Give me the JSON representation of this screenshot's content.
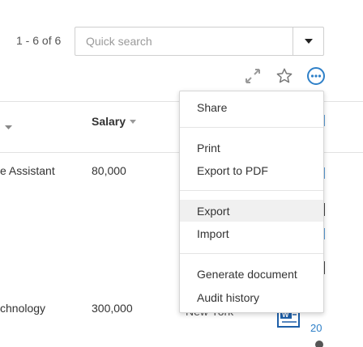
{
  "pager": {
    "range_label": "1 - 6 of 6"
  },
  "search": {
    "placeholder": "Quick search",
    "value": ""
  },
  "toolbar": {
    "icons": [
      "expand-icon",
      "star-icon",
      "more-options-icon"
    ]
  },
  "table": {
    "columns": [
      {
        "label": ""
      },
      {
        "label": "Salary"
      }
    ],
    "rows": [
      {
        "title": "e Assistant",
        "salary": "80,000"
      },
      {
        "title": "chnology",
        "salary": "300,000",
        "location_partial": "New York"
      }
    ],
    "partial_right_text": [
      "Gr",
      "20"
    ]
  },
  "menu": {
    "sections": [
      [
        {
          "label": "Share"
        }
      ],
      [
        {
          "label": "Print"
        },
        {
          "label": "Export to PDF"
        }
      ],
      [
        {
          "label": "Export",
          "highlighted": true
        },
        {
          "label": "Import"
        }
      ],
      [
        {
          "label": "Generate document"
        },
        {
          "label": "Audit history"
        }
      ]
    ]
  },
  "colors": {
    "accent": "#2f80c8",
    "hover": "#f0f0f0",
    "border": "#d6d6d6"
  }
}
